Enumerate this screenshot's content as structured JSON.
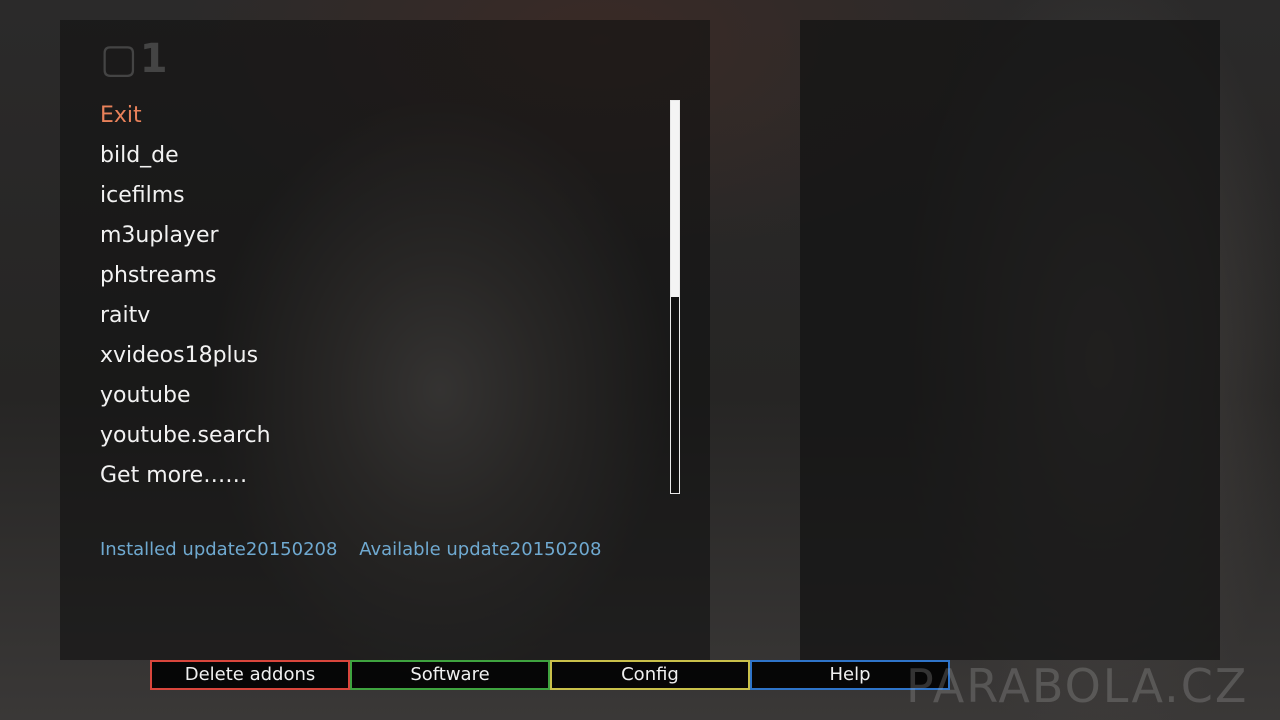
{
  "channel_logo": "1",
  "menu": {
    "selected_index": 0,
    "items": [
      "Exit",
      "bild_de",
      "icefilms",
      "m3uplayer",
      "phstreams",
      "raitv",
      "xvideos18plus",
      "youtube",
      "youtube.search",
      "Get more……"
    ]
  },
  "scrollbar": {
    "thumb_fraction": 0.5,
    "thumb_position": 0
  },
  "status": {
    "installed": "Installed update20150208",
    "available": "Available update20150208"
  },
  "buttons": [
    {
      "label": "Delete addons",
      "color": "#d9463c"
    },
    {
      "label": "Software",
      "color": "#3fa33f"
    },
    {
      "label": "Config",
      "color": "#c9c04a"
    },
    {
      "label": "Help",
      "color": "#2f74c8"
    }
  ],
  "watermark": "PARABOLA.CZ",
  "colors": {
    "selected_item": "#e8815a",
    "status_text": "#6fa9d0"
  }
}
